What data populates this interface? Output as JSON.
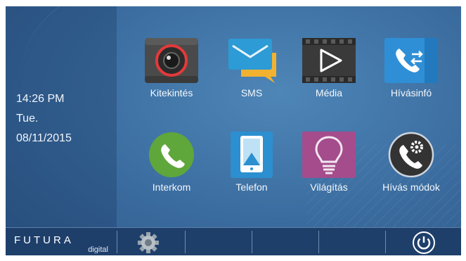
{
  "clock": {
    "time": "14:26   PM",
    "day": "Tue.",
    "date": "08/11/2015"
  },
  "apps": [
    {
      "label": "Kitekintés",
      "icon": "camera-icon"
    },
    {
      "label": "SMS",
      "icon": "message-icon"
    },
    {
      "label": "Média",
      "icon": "play-icon"
    },
    {
      "label": "Hívásinfó",
      "icon": "call-log-icon"
    },
    {
      "label": "Interkom",
      "icon": "phone-icon"
    },
    {
      "label": "Telefon",
      "icon": "tablet-icon"
    },
    {
      "label": "Világítás",
      "icon": "lightbulb-icon"
    },
    {
      "label": "Hívás módok",
      "icon": "call-settings-icon"
    }
  ],
  "brand": {
    "name": "FUTURA",
    "sub": "digital"
  },
  "colors": {
    "background": "#3b6c9f",
    "bottom_bar": "#1f3f6b",
    "sms_tile": "#2d9bd6",
    "media_tile": "#3a3a3a",
    "callinfo_tile": "#2f8fd6",
    "intercom_tile": "#5fa63b",
    "phone_tile": "#2b8fd0",
    "light_tile": "#a44c8c"
  }
}
